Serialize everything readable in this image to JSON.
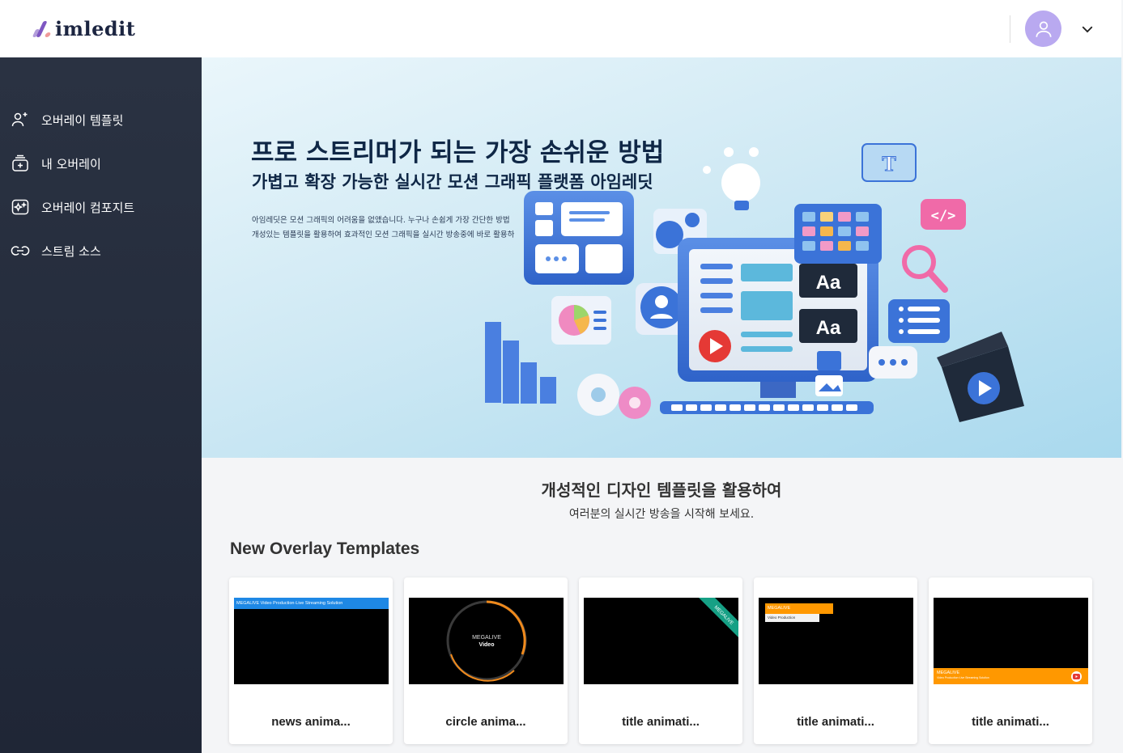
{
  "header": {
    "brand": "imledit",
    "avatar_icon": "user-icon",
    "menu_icon": "chevron-down-icon"
  },
  "sidebar": {
    "items": [
      {
        "label": "오버레이 템플릿",
        "icon": "user-plus-icon"
      },
      {
        "label": "내 오버레이",
        "icon": "layers-add-icon"
      },
      {
        "label": "오버레이 컴포지트",
        "icon": "sparkle-icon"
      },
      {
        "label": "스트림 소스",
        "icon": "link-icon"
      }
    ]
  },
  "hero": {
    "title": "프로 스트리머가 되는 가장 손쉬운 방법",
    "subtitle": "가볍고 확장 가능한 실시간 모션 그래픽 플랫폼 아임레딧",
    "desc_line1": "아임레딧은 모션 그래픽의 어려움을 없앴습니다. 누구나 손쉽게 가장 간단한 방법",
    "desc_line2": "개성있는 템플릿을 활용하여 효과적인 모션 그래픽을 실시간 방송중에 바로 활용하",
    "illustration": {
      "monitor_text_1": "Aa",
      "monitor_text_2": "Aa",
      "code_tag": "</>",
      "t_card": "T"
    }
  },
  "intro": {
    "title": "개성적인 디자인 템플릿을 활용하여",
    "subtitle": "여러분의 실시간 방송을 시작해 보세요."
  },
  "templates": {
    "heading": "New Overlay Templates",
    "items": [
      {
        "title": "news anima...",
        "thumb_text": "MEGALIVE Video Production·Live Streaming Solution"
      },
      {
        "title": "circle anima...",
        "thumb_text_1": "MEGALIVE",
        "thumb_text_2": "Video"
      },
      {
        "title": "title animati...",
        "thumb_text": "MEGALIVE"
      },
      {
        "title": "title animati...",
        "thumb_text_1": "MEGALIVE",
        "thumb_text_2": "Video Production"
      },
      {
        "title": "title animati...",
        "thumb_text_1": "MEGALIVE",
        "thumb_text_2": "Video Production·Live Streaming Solution"
      }
    ]
  },
  "colors": {
    "sidebar_bg": "#1f2636",
    "accent_purple": "#b9a9f0",
    "thumb_blue": "#1e88e5",
    "thumb_orange": "#ff9800",
    "thumb_green": "#16a085"
  }
}
